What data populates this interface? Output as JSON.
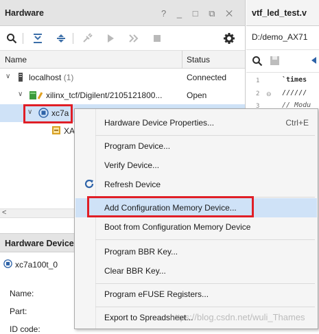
{
  "hardware_panel": {
    "title": "Hardware",
    "window_controls": "? _ □ ⧉ ✕",
    "columns": {
      "name": "Name",
      "status": "Status"
    },
    "tree": [
      {
        "label": "localhost",
        "count": "(1)",
        "status": "Connected"
      },
      {
        "label": "xilinx_tcf/Digilent/2105121800...",
        "status": "Open"
      },
      {
        "label": "xc7a",
        "status": ""
      },
      {
        "label": "XA",
        "status": ""
      }
    ]
  },
  "hardware_device_panel": {
    "title": "Hardware Device",
    "device": "xc7a100t_0",
    "props": [
      "Name:",
      "Part:",
      "ID code:"
    ]
  },
  "editor": {
    "tab_title": "vtf_led_test.v",
    "path": "D:/demo_AX71",
    "lines": [
      {
        "num": "1",
        "text": "`times"
      },
      {
        "num": "2",
        "text": "//////"
      },
      {
        "num": "3",
        "text": "// Modu"
      }
    ]
  },
  "context_menu": {
    "items": [
      {
        "label": "Hardware Device Properties...",
        "shortcut": "Ctrl+E"
      },
      {
        "label": "Program Device..."
      },
      {
        "label": "Verify Device..."
      },
      {
        "label": "Refresh Device"
      },
      {
        "label": "Add Configuration Memory Device..."
      },
      {
        "label": "Boot from Configuration Memory Device"
      },
      {
        "label": "Program BBR Key..."
      },
      {
        "label": "Clear BBR Key..."
      },
      {
        "label": "Program eFUSE Registers..."
      },
      {
        "label": "Export to Spreadsheet..."
      }
    ]
  },
  "watermark": "https://blog.csdn.net/wuli_Thames",
  "colors": {
    "accent": "#3b6ea8",
    "highlight": "#cfe2f7",
    "callout": "#e01e26"
  }
}
